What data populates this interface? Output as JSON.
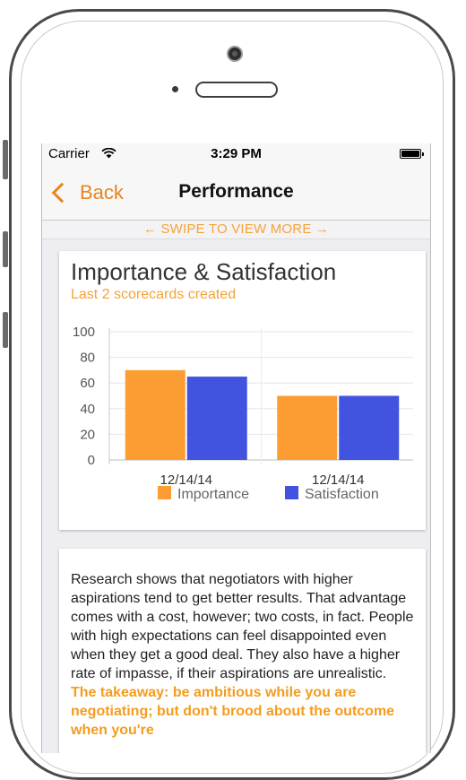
{
  "status": {
    "carrier": "Carrier",
    "time": "3:29 PM"
  },
  "nav": {
    "back_label": "Back",
    "title": "Performance"
  },
  "swipe": {
    "left_arrow": "←",
    "label": "SWIPE TO VIEW MORE",
    "right_arrow": "→"
  },
  "chart_card": {
    "title": "Importance & Satisfaction",
    "subtitle": "Last 2 scorecards created"
  },
  "chart_data": {
    "type": "bar",
    "categories": [
      "12/14/14",
      "12/14/14"
    ],
    "series": [
      {
        "name": "Importance",
        "values": [
          70,
          50
        ],
        "color": "#fb9d32"
      },
      {
        "name": "Satisfaction",
        "values": [
          65,
          50
        ],
        "color": "#4253e0"
      }
    ],
    "ylim": [
      0,
      100
    ],
    "yticks": [
      0,
      20,
      40,
      60,
      80,
      100
    ],
    "grid": true,
    "legend": "bottom"
  },
  "text_card": {
    "body": "Research shows that negotiators with higher aspirations tend to get better results. That advantage comes with a cost, however; two costs, in fact. People with high expectations can feel disappointed even when they get a good deal. They also have a higher rate of impasse, if their aspirations are unrealistic. ",
    "highlight": "The takeaway: be ambitious while you are negotiating; but don't brood about the outcome when you're"
  }
}
